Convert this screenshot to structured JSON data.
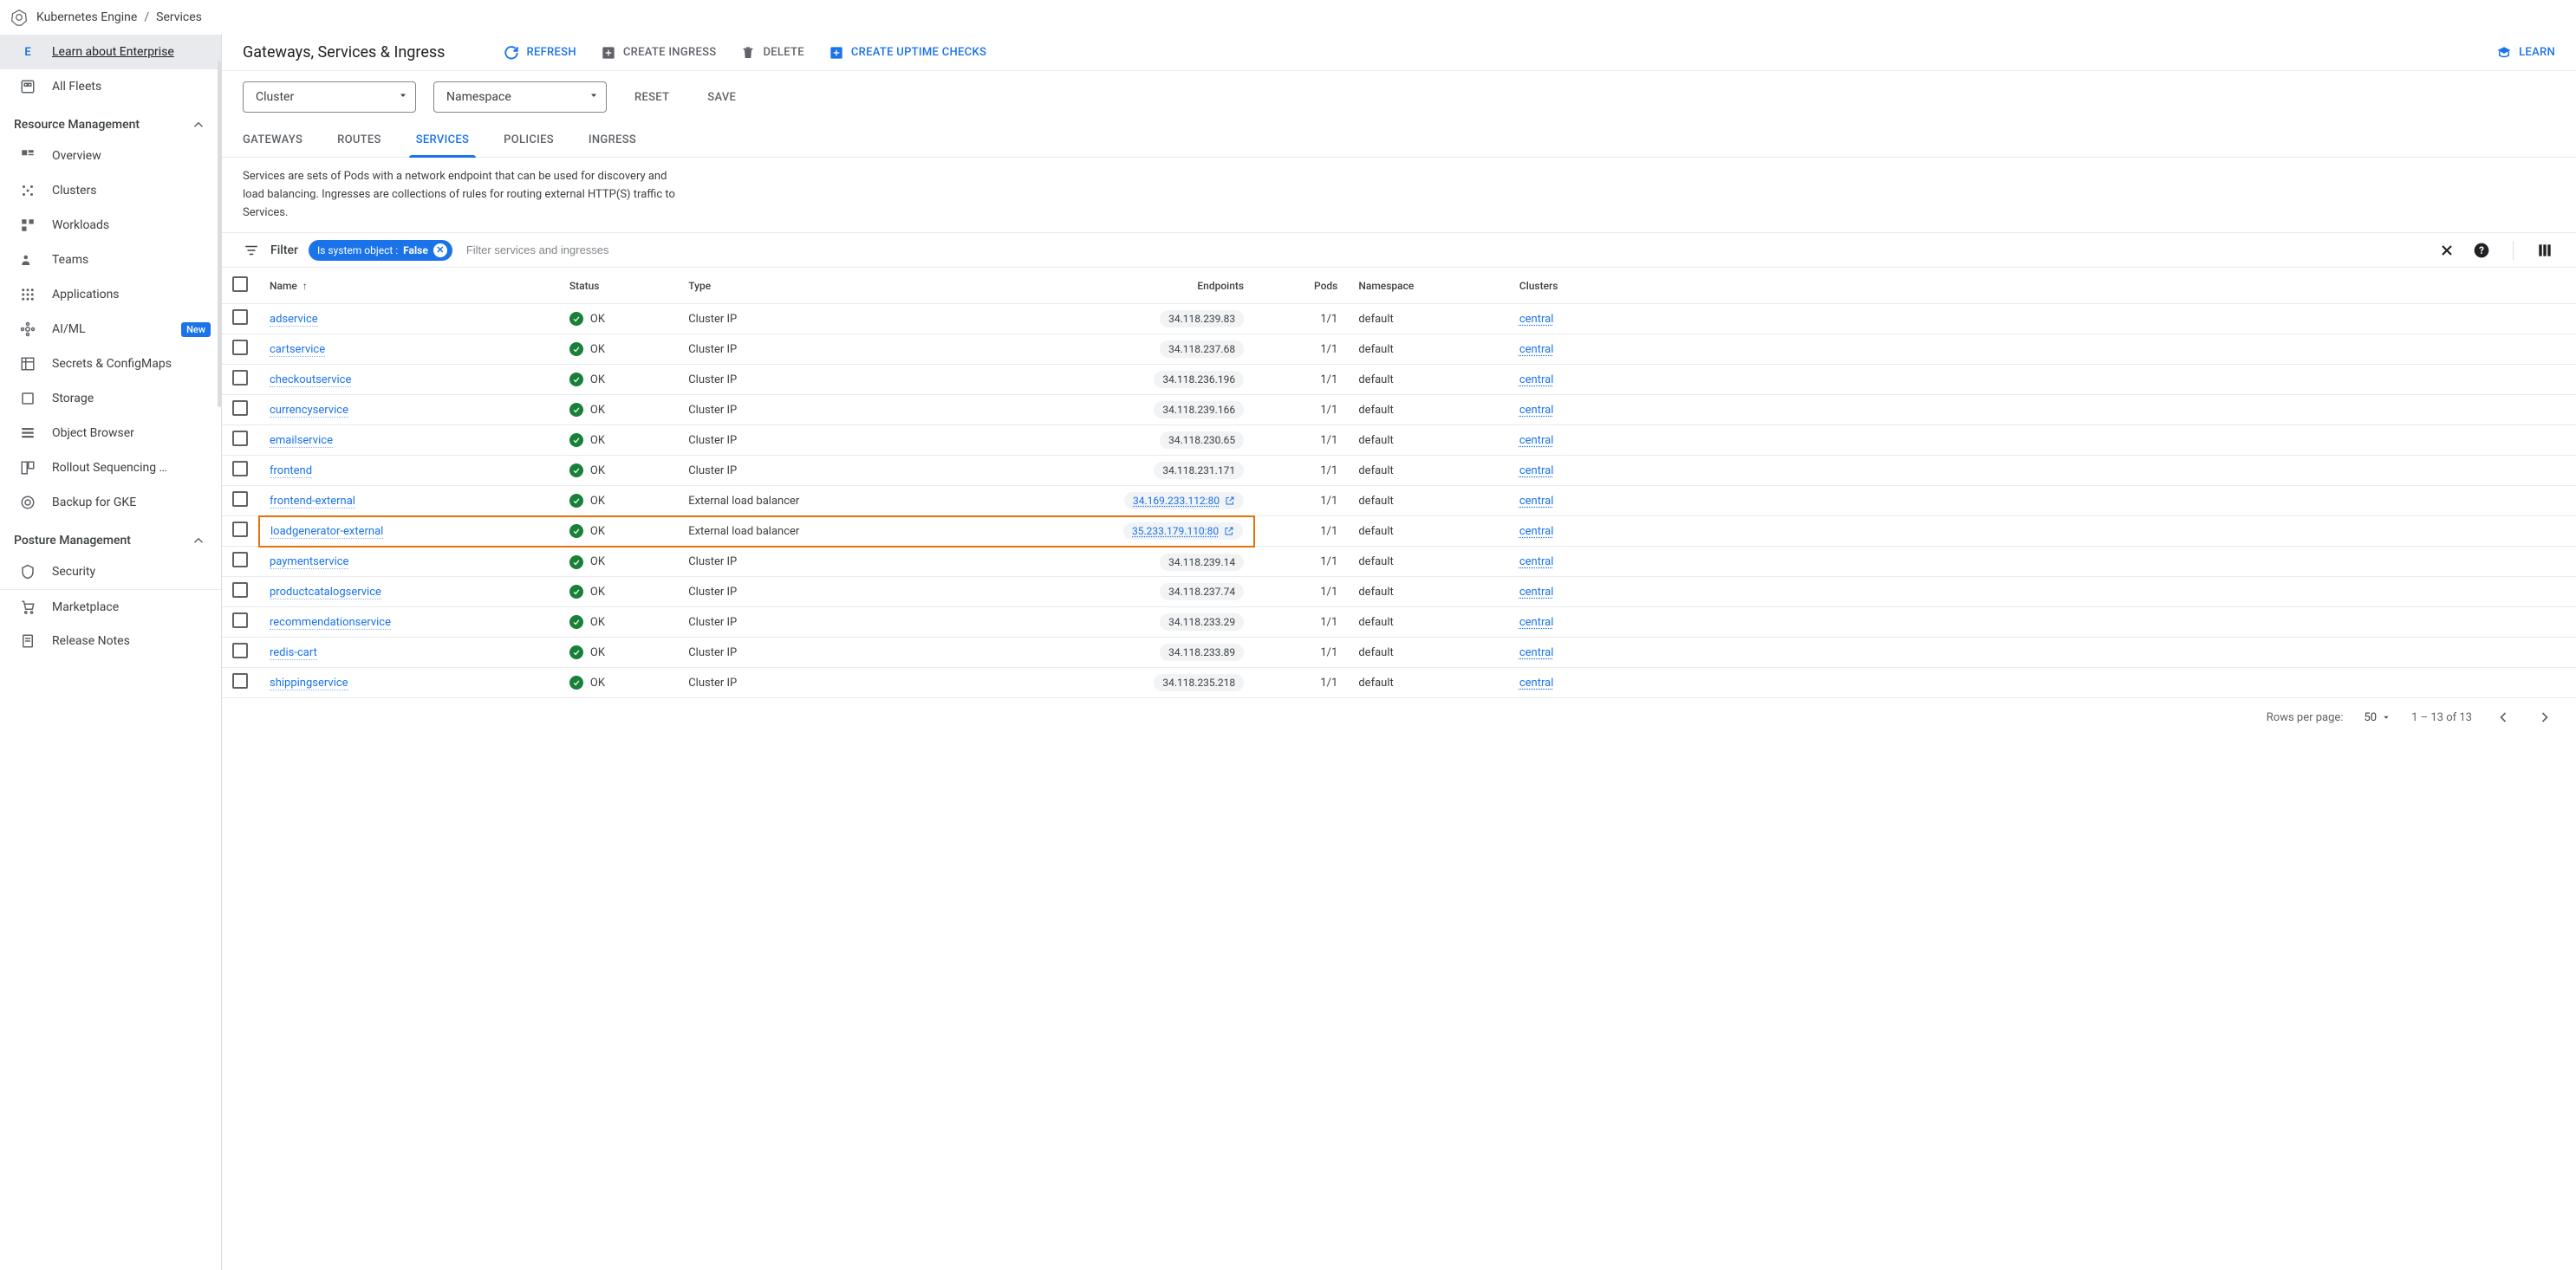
{
  "breadcrumb": {
    "app": "Kubernetes Engine",
    "page": "Services"
  },
  "sidebar": {
    "enterprise": {
      "e": "E",
      "label": "Learn about Enterprise"
    },
    "fleets": "All Fleets",
    "sections": {
      "resource_mgmt": "Resource Management",
      "posture_mgmt": "Posture Management"
    },
    "items": {
      "overview": "Overview",
      "clusters": "Clusters",
      "workloads": "Workloads",
      "teams": "Teams",
      "applications": "Applications",
      "aiml": "AI/ML",
      "secrets": "Secrets & ConfigMaps",
      "storage": "Storage",
      "object_browser": "Object Browser",
      "rollout": "Rollout Sequencing …",
      "backup": "Backup for GKE",
      "security": "Security",
      "marketplace": "Marketplace",
      "release_notes": "Release Notes"
    },
    "badges": {
      "new": "New"
    }
  },
  "header": {
    "title": "Gateways, Services & Ingress",
    "refresh": "REFRESH",
    "create_ingress": "CREATE INGRESS",
    "delete": "DELETE",
    "create_uptime": "CREATE UPTIME CHECKS",
    "learn": "LEARN"
  },
  "selectors": {
    "cluster": "Cluster",
    "namespace": "Namespace",
    "reset": "RESET",
    "save": "SAVE"
  },
  "tabs": {
    "gateways": "GATEWAYS",
    "routes": "ROUTES",
    "services": "SERVICES",
    "policies": "POLICIES",
    "ingress": "INGRESS"
  },
  "description": "Services are sets of Pods with a network endpoint that can be used for discovery and load balancing. Ingresses are collections of rules for routing external HTTP(S) traffic to Services.",
  "filter": {
    "label": "Filter",
    "chip_key": "Is system object : ",
    "chip_value": "False",
    "placeholder": "Filter services and ingresses"
  },
  "columns": {
    "name": "Name",
    "status": "Status",
    "type": "Type",
    "endpoints": "Endpoints",
    "pods": "Pods",
    "namespace": "Namespace",
    "clusters": "Clusters"
  },
  "status_ok": "OK",
  "rows": [
    {
      "name": "adservice",
      "type": "Cluster IP",
      "endpoint": "34.118.239.83",
      "external": false,
      "pods": "1/1",
      "namespace": "default",
      "cluster": "central",
      "highlight": false
    },
    {
      "name": "cartservice",
      "type": "Cluster IP",
      "endpoint": "34.118.237.68",
      "external": false,
      "pods": "1/1",
      "namespace": "default",
      "cluster": "central",
      "highlight": false
    },
    {
      "name": "checkoutservice",
      "type": "Cluster IP",
      "endpoint": "34.118.236.196",
      "external": false,
      "pods": "1/1",
      "namespace": "default",
      "cluster": "central",
      "highlight": false
    },
    {
      "name": "currencyservice",
      "type": "Cluster IP",
      "endpoint": "34.118.239.166",
      "external": false,
      "pods": "1/1",
      "namespace": "default",
      "cluster": "central",
      "highlight": false
    },
    {
      "name": "emailservice",
      "type": "Cluster IP",
      "endpoint": "34.118.230.65",
      "external": false,
      "pods": "1/1",
      "namespace": "default",
      "cluster": "central",
      "highlight": false
    },
    {
      "name": "frontend",
      "type": "Cluster IP",
      "endpoint": "34.118.231.171",
      "external": false,
      "pods": "1/1",
      "namespace": "default",
      "cluster": "central",
      "highlight": false
    },
    {
      "name": "frontend-external",
      "type": "External load balancer",
      "endpoint": "34.169.233.112:80",
      "external": true,
      "pods": "1/1",
      "namespace": "default",
      "cluster": "central",
      "highlight": false
    },
    {
      "name": "loadgenerator-external",
      "type": "External load balancer",
      "endpoint": "35.233.179.110:80",
      "external": true,
      "pods": "1/1",
      "namespace": "default",
      "cluster": "central",
      "highlight": true
    },
    {
      "name": "paymentservice",
      "type": "Cluster IP",
      "endpoint": "34.118.239.14",
      "external": false,
      "pods": "1/1",
      "namespace": "default",
      "cluster": "central",
      "highlight": false
    },
    {
      "name": "productcatalogservice",
      "type": "Cluster IP",
      "endpoint": "34.118.237.74",
      "external": false,
      "pods": "1/1",
      "namespace": "default",
      "cluster": "central",
      "highlight": false
    },
    {
      "name": "recommendationservice",
      "type": "Cluster IP",
      "endpoint": "34.118.233.29",
      "external": false,
      "pods": "1/1",
      "namespace": "default",
      "cluster": "central",
      "highlight": false
    },
    {
      "name": "redis-cart",
      "type": "Cluster IP",
      "endpoint": "34.118.233.89",
      "external": false,
      "pods": "1/1",
      "namespace": "default",
      "cluster": "central",
      "highlight": false
    },
    {
      "name": "shippingservice",
      "type": "Cluster IP",
      "endpoint": "34.118.235.218",
      "external": false,
      "pods": "1/1",
      "namespace": "default",
      "cluster": "central",
      "highlight": false
    }
  ],
  "pagination": {
    "rows_per_page": "Rows per page:",
    "page_size": "50",
    "range": "1 – 13 of 13"
  }
}
